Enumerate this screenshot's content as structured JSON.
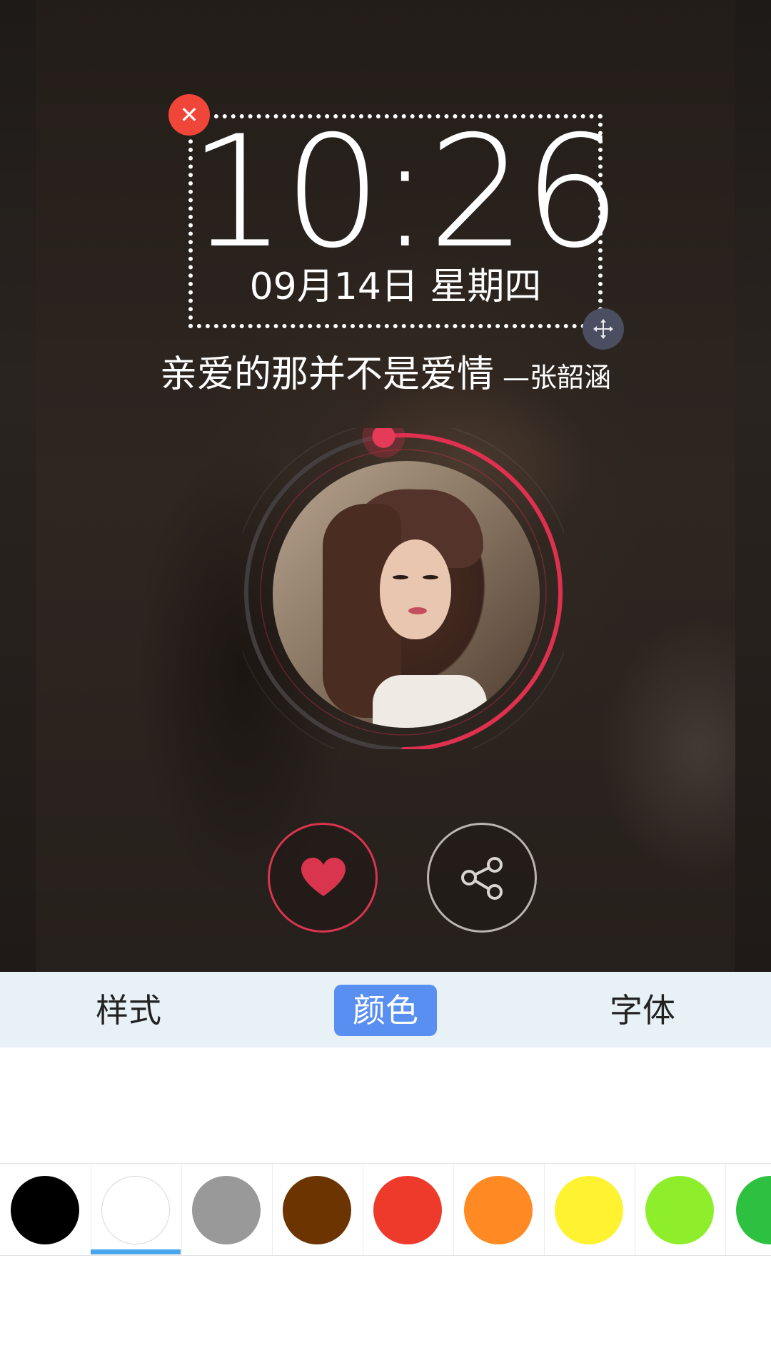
{
  "lockscreen": {
    "time": "10:26",
    "date": "09月14日  星期四",
    "quote": "亲爱的那并不是爱情",
    "author": "—张韶涵",
    "close_icon": "close-icon",
    "move_icon": "move-arrows-icon",
    "progress": 0.52,
    "accent_color": "#e0304f"
  },
  "actions": {
    "like_icon": "heart-icon",
    "share_icon": "share-icon"
  },
  "tabs": [
    {
      "label": "样式",
      "selected": false
    },
    {
      "label": "颜色",
      "selected": true
    },
    {
      "label": "字体",
      "selected": false
    }
  ],
  "swatches": [
    {
      "color": "#000000",
      "selected": false
    },
    {
      "color": "#ffffff",
      "selected": true
    },
    {
      "color": "#999999",
      "selected": false
    },
    {
      "color": "#6b3400",
      "selected": false
    },
    {
      "color": "#ee3a2a",
      "selected": false
    },
    {
      "color": "#ff8a24",
      "selected": false
    },
    {
      "color": "#fff230",
      "selected": false
    },
    {
      "color": "#8fee2c",
      "selected": false
    },
    {
      "color": "#2ec040",
      "selected": false
    }
  ]
}
